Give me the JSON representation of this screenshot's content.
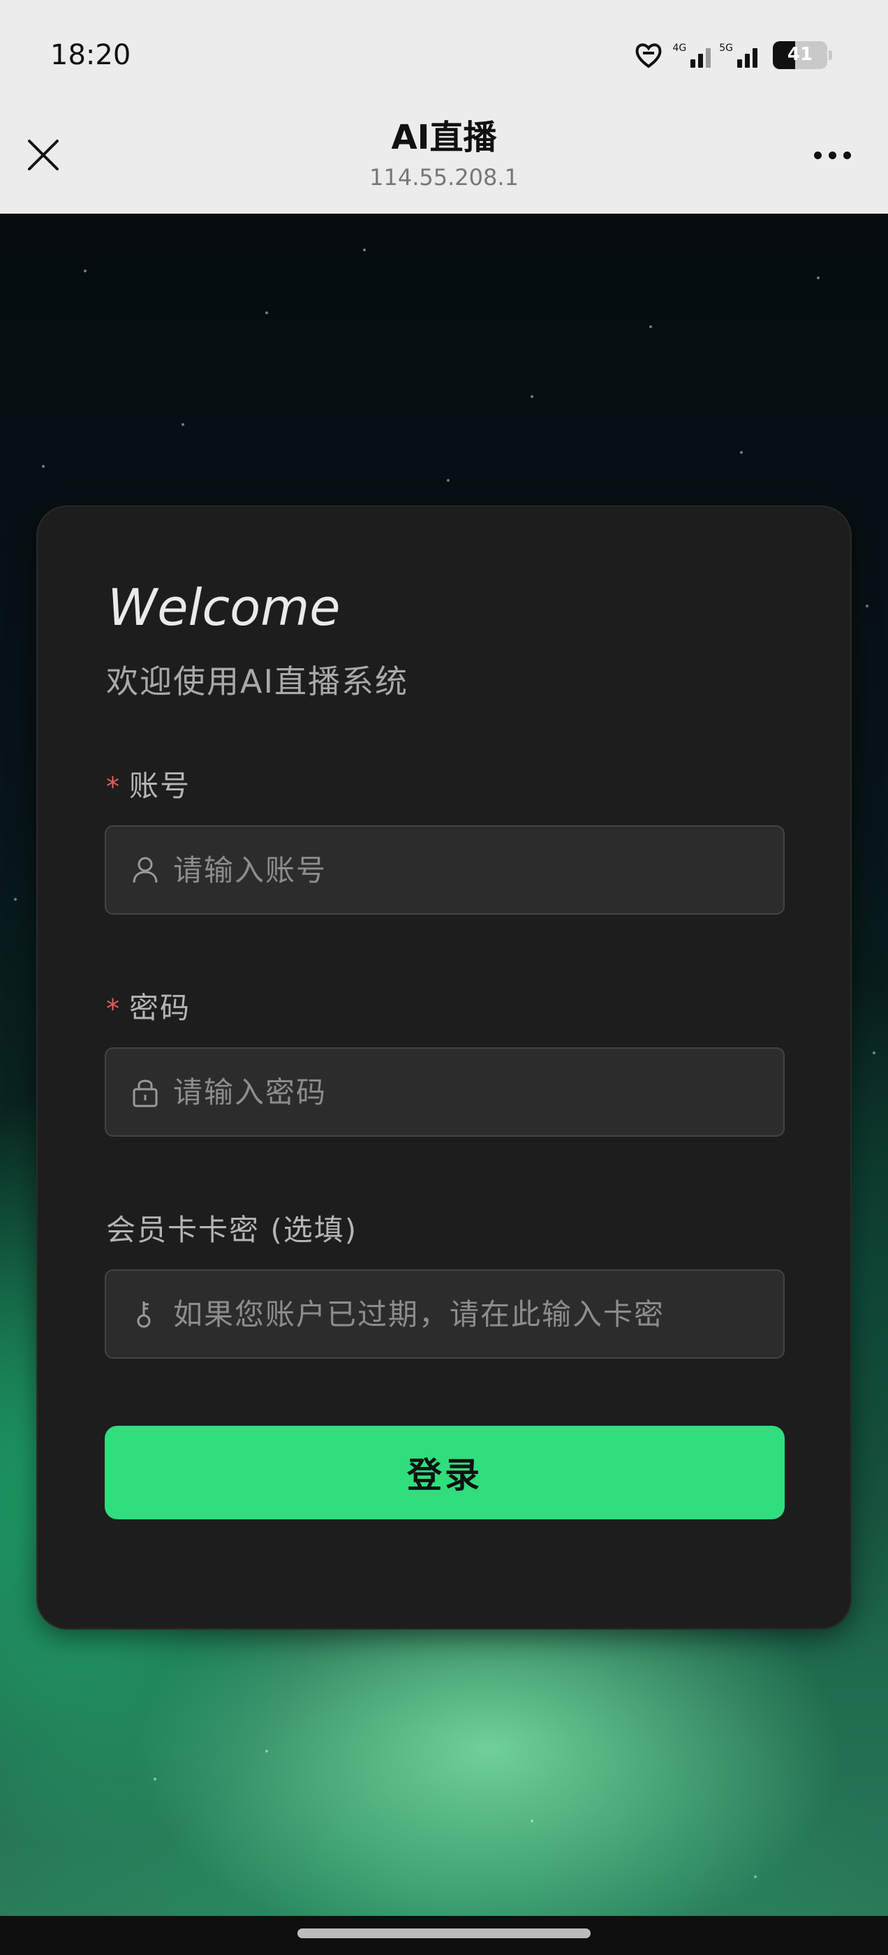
{
  "status_bar": {
    "time": "18:20",
    "signal1_label": "4G",
    "signal2_label": "5G",
    "battery_level": "41"
  },
  "title_bar": {
    "title": "AI直播",
    "subtitle": "114.55.208.1"
  },
  "login": {
    "welcome": "Welcome",
    "subtitle": "欢迎使用AI直播系统",
    "required_mark": "*",
    "account_label": "账号",
    "account_placeholder": "请输入账号",
    "password_label": "密码",
    "password_placeholder": "请输入密码",
    "card_label": "会员卡卡密 (选填)",
    "card_placeholder": "如果您账户已过期，请在此输入卡密",
    "submit_label": "登录"
  },
  "colors": {
    "accent": "#30de7d",
    "card_bg": "#1d1d1d",
    "required": "#e06060"
  },
  "icons": [
    "close-icon",
    "more-icon",
    "user-icon",
    "lock-icon",
    "key-icon"
  ]
}
